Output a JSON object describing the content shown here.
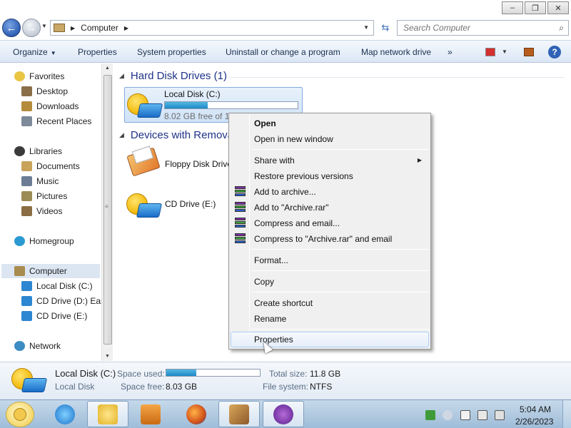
{
  "window": {
    "caption_buttons": {
      "minimize": "–",
      "maximize": "❐",
      "close": "✕"
    }
  },
  "address": {
    "back_glyph": "←",
    "forward_glyph": "→",
    "location": "Computer",
    "refresh_glyph": "⇆",
    "search_placeholder": "Search Computer"
  },
  "toolbar": {
    "organize": "Organize",
    "properties": "Properties",
    "system_properties": "System properties",
    "uninstall": "Uninstall or change a program",
    "map_drive": "Map network drive",
    "more": "»",
    "help": "?"
  },
  "sidebar": {
    "favorites": "Favorites",
    "desktop": "Desktop",
    "downloads": "Downloads",
    "recent_places": "Recent Places",
    "libraries": "Libraries",
    "documents": "Documents",
    "music": "Music",
    "pictures": "Pictures",
    "videos": "Videos",
    "homegroup": "Homegroup",
    "computer": "Computer",
    "local_disk": "Local Disk (C:)",
    "cd_drive_d": "CD Drive (D:) Eas",
    "cd_drive_e": "CD Drive (E:)",
    "network": "Network"
  },
  "content": {
    "hdd_header": "Hard Disk Drives (1)",
    "removable_header": "Devices with Remova",
    "local_disk_name": "Local Disk (C:)",
    "local_disk_free": "8.02 GB free of 11",
    "local_disk_used_fraction": 0.32,
    "floppy_name": "Floppy Disk Drive",
    "cd_name": "CD Drive (E:)"
  },
  "context_menu": {
    "open": "Open",
    "open_new_window": "Open in new window",
    "share_with": "Share with",
    "restore": "Restore previous versions",
    "add_archive": "Add to archive...",
    "add_archive_rar": "Add to \"Archive.rar\"",
    "compress_email": "Compress and email...",
    "compress_rar_email": "Compress to \"Archive.rar\" and email",
    "format": "Format...",
    "copy": "Copy",
    "create_shortcut": "Create shortcut",
    "rename": "Rename",
    "properties": "Properties"
  },
  "details": {
    "name": "Local Disk (C:)",
    "type": "Local Disk",
    "space_used_label": "Space used:",
    "space_used_fraction": 0.32,
    "space_free_label": "Space free:",
    "space_free_value": "8.03 GB",
    "total_size_label": "Total size:",
    "total_size_value": "11.8 GB",
    "file_system_label": "File system:",
    "file_system_value": "NTFS"
  },
  "taskbar": {
    "time": "5:04 AM",
    "date": "2/26/2023"
  },
  "colors": {
    "link_blue": "#1e3287",
    "command_text": "#1b3151",
    "selection": "#dce6f2",
    "bar_fill": "#1e89c5"
  }
}
